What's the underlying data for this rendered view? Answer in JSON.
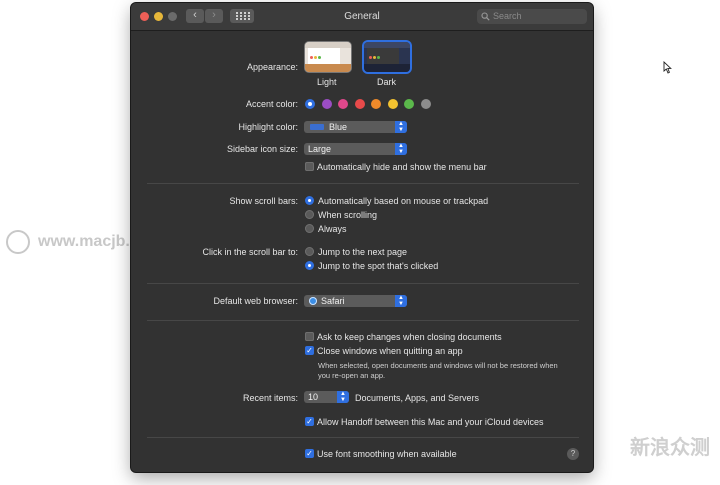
{
  "window": {
    "title": "General"
  },
  "search": {
    "placeholder": "Search"
  },
  "appearance": {
    "label": "Appearance:",
    "options": [
      "Light",
      "Dark"
    ]
  },
  "accent": {
    "label": "Accent color:",
    "colors": [
      "#2f6fe0",
      "#9b4dc4",
      "#e0488c",
      "#e84a4a",
      "#f08a2a",
      "#f2c230",
      "#5bb84b",
      "#8c8c8c"
    ]
  },
  "highlight": {
    "label": "Highlight color:",
    "value": "Blue"
  },
  "sidebar_icon": {
    "label": "Sidebar icon size:",
    "value": "Large"
  },
  "menubar": {
    "label": "Automatically hide and show the menu bar"
  },
  "scrollbars": {
    "label": "Show scroll bars:",
    "options": [
      "Automatically based on mouse or trackpad",
      "When scrolling",
      "Always"
    ]
  },
  "scrollclick": {
    "label": "Click in the scroll bar to:",
    "options": [
      "Jump to the next page",
      "Jump to the spot that's clicked"
    ]
  },
  "browser": {
    "label": "Default web browser:",
    "value": "Safari"
  },
  "ask_keep": {
    "label": "Ask to keep changes when closing documents"
  },
  "close_windows": {
    "label": "Close windows when quitting an app",
    "note": "When selected, open documents and windows will not be restored when you re-open an app."
  },
  "recent": {
    "label": "Recent items:",
    "value": "10",
    "suffix": "Documents, Apps, and Servers"
  },
  "handoff": {
    "label": "Allow Handoff between this Mac and your iCloud devices"
  },
  "font_smoothing": {
    "label": "Use font smoothing when available"
  },
  "help": {
    "glyph": "?"
  },
  "watermark_left": "www.macjb.com",
  "watermark_right": "新浪众测"
}
